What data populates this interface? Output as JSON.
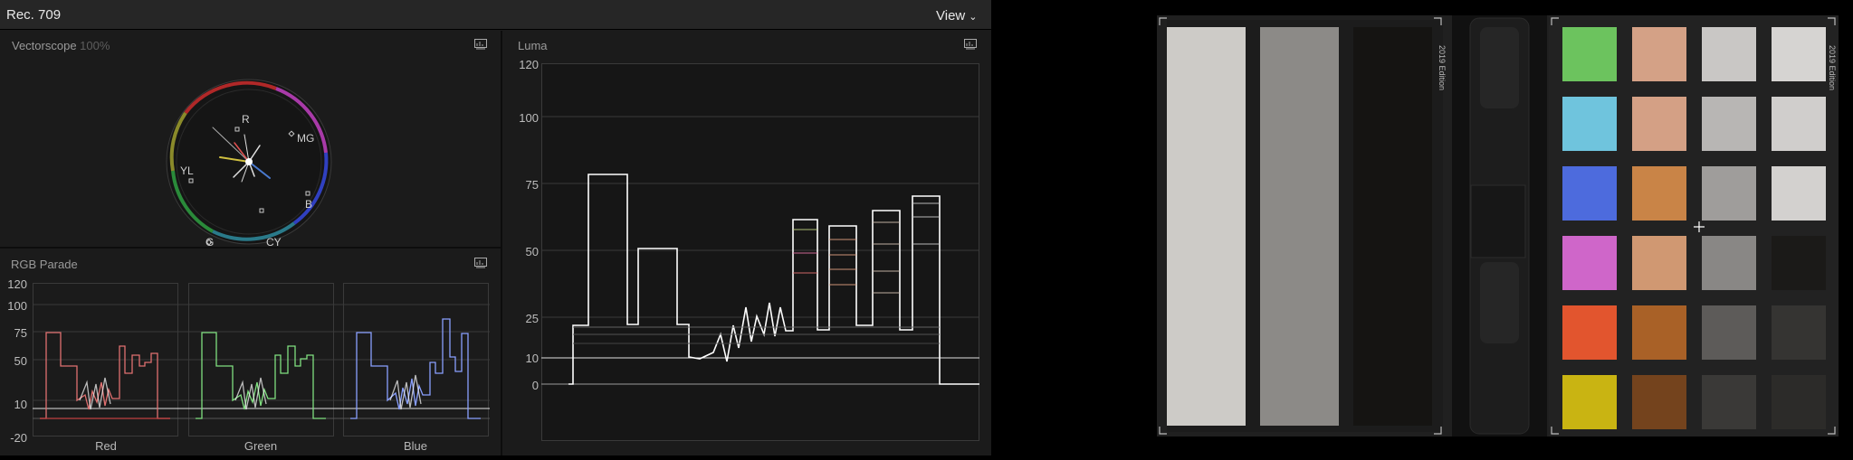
{
  "header": {
    "color_space": "Rec. 709",
    "view_menu": "View"
  },
  "vectorscope": {
    "title": "Vectorscope",
    "zoom": "100%",
    "targets": [
      "R",
      "MG",
      "B",
      "CY",
      "G",
      "YL"
    ]
  },
  "rgb_parade": {
    "title": "RGB Parade",
    "scale": [
      "120",
      "100",
      "75",
      "50",
      "10",
      "-20"
    ],
    "channels": [
      "Red",
      "Green",
      "Blue"
    ]
  },
  "luma": {
    "title": "Luma",
    "scale": [
      "120",
      "100",
      "75",
      "50",
      "25",
      "10",
      "0"
    ]
  },
  "viewer": {
    "chart_edition_left": "2019 Edition",
    "chart_edition_right": "2019 Edition"
  },
  "colors": {
    "red": "#e06060",
    "green": "#70d070",
    "blue": "#7090ff",
    "vector_ring": "#5a5a5a"
  }
}
